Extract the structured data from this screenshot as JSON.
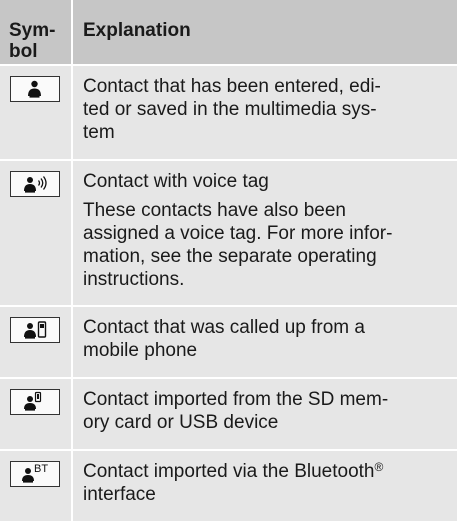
{
  "header": {
    "symbol_label": "Sym-\nbol",
    "explanation_label": "Explanation"
  },
  "rows": [
    {
      "icon": "contact-person-icon",
      "text": "Contact that has been entered, edi-\nted or saved in the multimedia sys-\ntem"
    },
    {
      "icon": "contact-voice-tag-icon",
      "text": "Contact with voice tag",
      "text2": "These contacts have also been\nassigned a voice tag. For more infor-\nmation, see the separate operating\ninstructions."
    },
    {
      "icon": "contact-mobile-phone-icon",
      "text": "Contact that was called up from a\nmobile phone"
    },
    {
      "icon": "contact-sd-card-icon",
      "text": "Contact imported from the SD mem-\nory card or USB device"
    },
    {
      "icon": "contact-bluetooth-icon",
      "bt_label": "BT",
      "text_before": "Contact imported via the Bluetooth",
      "reg": "®",
      "text_after": "interface"
    }
  ]
}
